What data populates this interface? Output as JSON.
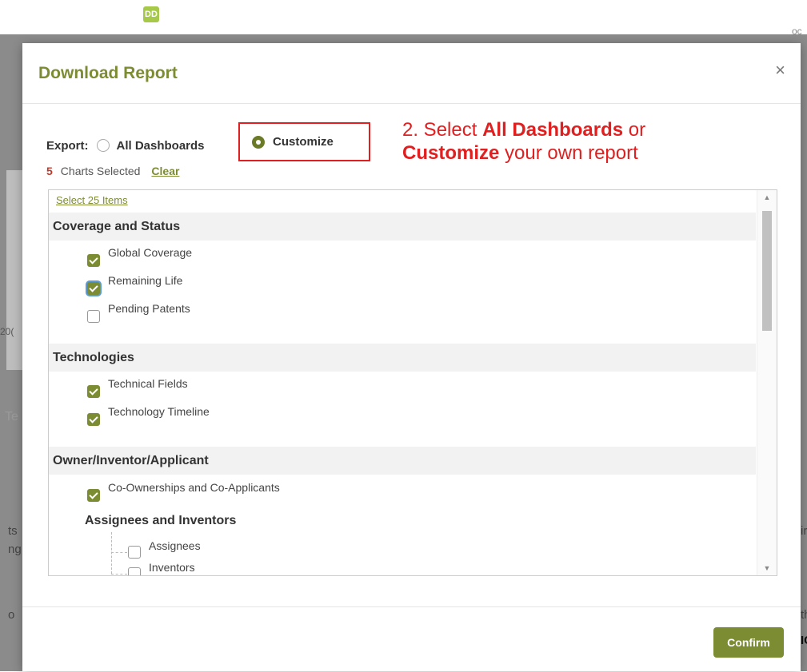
{
  "background": {
    "logo": "DD",
    "right_top_frag": "oc",
    "left_label_1": "20(",
    "left_label_2": "Te",
    "left_label_3": "ts",
    "left_label_4": "ng",
    "left_label_5": "o",
    "right_label_1": "ir",
    "right_label_2": "th",
    "right_label_3": "IC"
  },
  "modal": {
    "title": "Download Report",
    "close_glyph": "×",
    "export_label": "Export:",
    "export_options": [
      {
        "label": "All Dashboards",
        "selected": false
      },
      {
        "label": "Customize",
        "selected": true
      }
    ],
    "charts_selected_count": "5",
    "charts_selected_text": "Charts Selected",
    "clear_label": "Clear",
    "select_all_label": "Select 25 Items",
    "sections": [
      {
        "title": "Coverage and Status",
        "items": [
          {
            "label": "Global Coverage",
            "checked": true
          },
          {
            "label": "Remaining Life",
            "checked": true
          },
          {
            "label": "Pending Patents",
            "checked": false
          }
        ]
      },
      {
        "title": "Technologies",
        "items": [
          {
            "label": "Technical Fields",
            "checked": true
          },
          {
            "label": "Technology Timeline",
            "checked": true
          }
        ]
      },
      {
        "title": "Owner/Inventor/Applicant",
        "items": [
          {
            "label": "Co-Ownerships and Co-Applicants",
            "checked": true
          }
        ],
        "subgroup": {
          "title": "Assignees and Inventors",
          "items": [
            {
              "label": "Assignees",
              "checked": false
            },
            {
              "label": "Inventors",
              "checked": false
            }
          ]
        }
      }
    ],
    "confirm_label": "Confirm"
  },
  "annotation": {
    "prefix": "2. Select ",
    "bold1": "All Dashboards",
    "mid": " or",
    "bold2": "Customize",
    "suffix": " your own report"
  },
  "colors": {
    "brand_green": "#7c8c32",
    "annotation_red": "#e02020",
    "count_red": "#c0392b"
  }
}
